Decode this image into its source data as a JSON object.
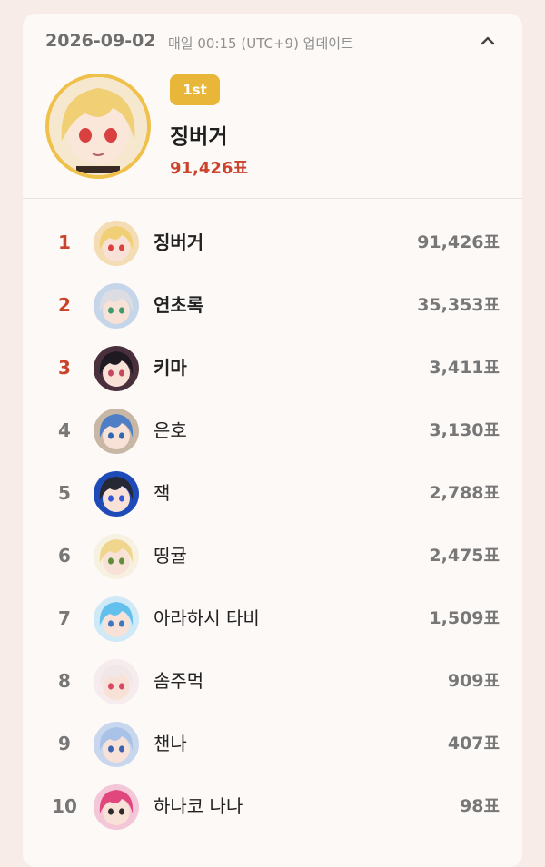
{
  "header": {
    "date": "2026-09-02",
    "update_text": "매일 00:15 (UTC+9) 업데이트",
    "collapse_icon": "chevron-up-icon"
  },
  "top_entry": {
    "badge": "1st",
    "name": "징버거",
    "votes": "91,426표",
    "accent_color": "#e8b73a"
  },
  "ranking": [
    {
      "rank": "1",
      "name": "징버거",
      "votes": "91,426표",
      "bg": "#f4dcb5",
      "hair": "#f1cf74",
      "eye": "#d94040"
    },
    {
      "rank": "2",
      "name": "연초록",
      "votes": "35,353표",
      "bg": "#c6d6ea",
      "hair": "#dcdde2",
      "eye": "#3f9a6c"
    },
    {
      "rank": "3",
      "name": "키마",
      "votes": "3,411표",
      "bg": "#4a2f3c",
      "hair": "#1f1a22",
      "eye": "#c44761"
    },
    {
      "rank": "4",
      "name": "은호",
      "votes": "3,130표",
      "bg": "#c7b7a4",
      "hair": "#4e7fc6",
      "eye": "#2f67b3"
    },
    {
      "rank": "5",
      "name": "잭",
      "votes": "2,788표",
      "bg": "#1f4bb8",
      "hair": "#262833",
      "eye": "#3456d5"
    },
    {
      "rank": "6",
      "name": "띵귤",
      "votes": "2,475표",
      "bg": "#f7f1e2",
      "hair": "#f0d58c",
      "eye": "#5e8f3a"
    },
    {
      "rank": "7",
      "name": "아라하시 타비",
      "votes": "1,509표",
      "bg": "#cfe9f6",
      "hair": "#63c0ec",
      "eye": "#3b78c1"
    },
    {
      "rank": "8",
      "name": "솜주먹",
      "votes": "909표",
      "bg": "#f6ecee",
      "hair": "#f2e7e8",
      "eye": "#d64a63"
    },
    {
      "rank": "9",
      "name": "챈나",
      "votes": "407표",
      "bg": "#c9d7ee",
      "hair": "#a8c2e8",
      "eye": "#3b63b0"
    },
    {
      "rank": "10",
      "name": "하나코 나나",
      "votes": "98표",
      "bg": "#f3c6d8",
      "hair": "#e1467c",
      "eye": "#2b2b2b"
    }
  ],
  "colors": {
    "page_bg": "#f8ece8",
    "card_bg": "#fdf9f7",
    "top3_rank": "#c9432d",
    "muted": "#777777"
  }
}
